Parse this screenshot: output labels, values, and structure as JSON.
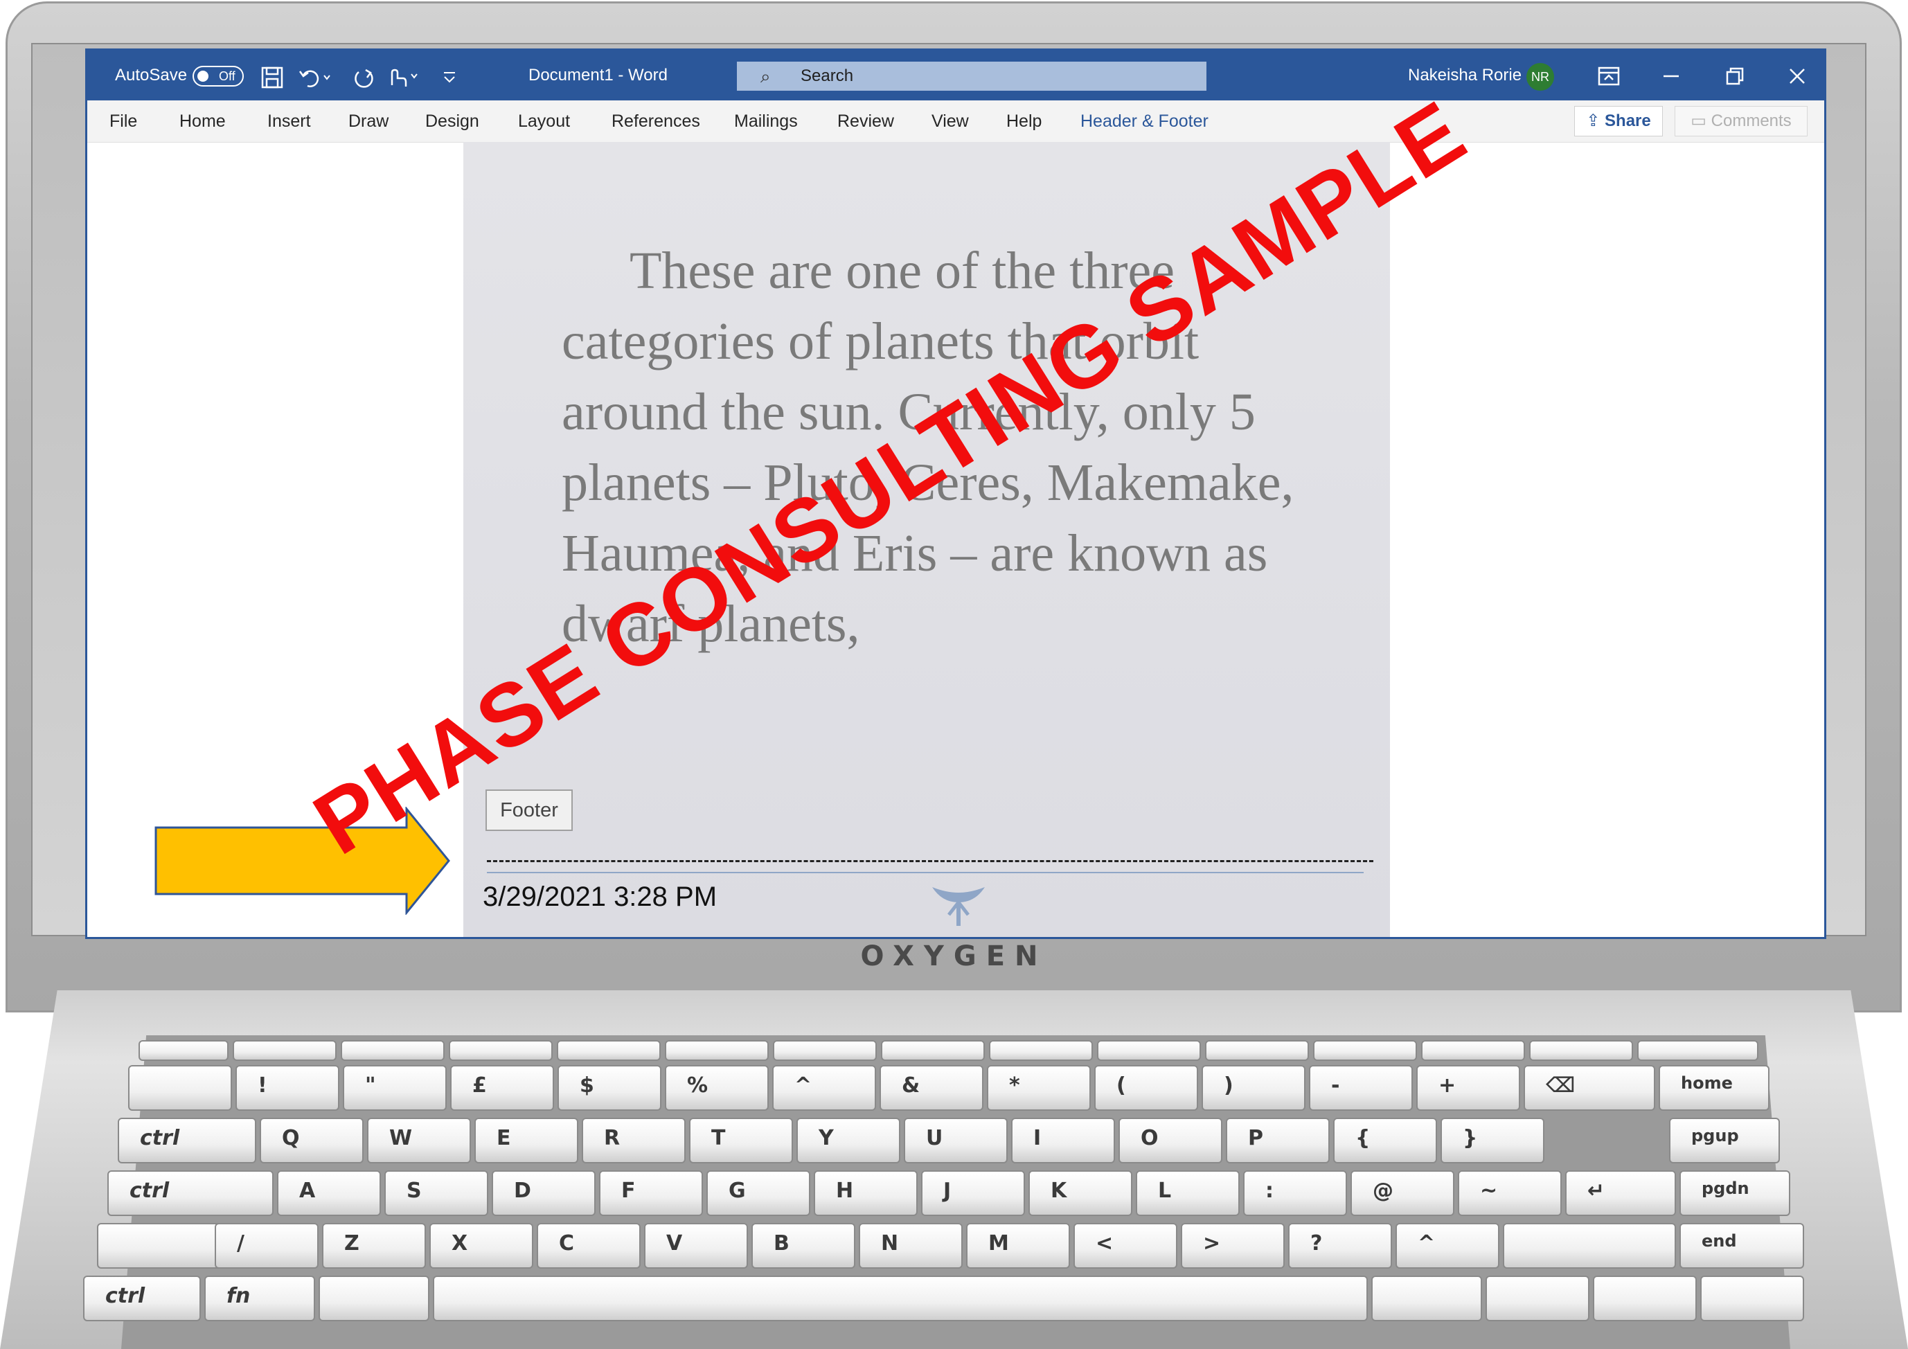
{
  "titlebar": {
    "autosave_label": "AutoSave",
    "autosave_state": "Off",
    "doc_title": "Document1  -  Word",
    "search_placeholder": "Search",
    "user_name": "Nakeisha Rorie",
    "user_initials": "NR"
  },
  "ribbon": {
    "tabs": [
      "File",
      "Home",
      "Insert",
      "Draw",
      "Design",
      "Layout",
      "References",
      "Mailings",
      "Review",
      "View",
      "Help",
      "Header & Footer"
    ],
    "active_tab": "Header & Footer",
    "share_label": "Share",
    "comments_label": "Comments"
  },
  "document": {
    "body_text": "These are one of the three categories of planets that orbit around the sun. Currently, only 5 planets – Pluto, Ceres, Makemake, Haumea, and Eris – are known as dwarf planets,",
    "footer_tag": "Footer",
    "footer_date": "3/29/2021 3:28 PM"
  },
  "laptop": {
    "brand": "OXYGEN"
  },
  "keyboard": {
    "row1": [
      "!",
      "\"",
      "£",
      "$",
      "%",
      "^",
      "&",
      "*",
      "(",
      ")",
      "-",
      "+",
      "⌫",
      "home"
    ],
    "row2": [
      "ctrl",
      "Q",
      "W",
      "E",
      "R",
      "T",
      "Y",
      "U",
      "I",
      "O",
      "P",
      "{",
      "}",
      "pgup"
    ],
    "row3": [
      "ctrl",
      "A",
      "S",
      "D",
      "F",
      "G",
      "H",
      "J",
      "K",
      "L",
      ":",
      "@",
      "~",
      "↵",
      "pgdn"
    ],
    "row4": [
      "/",
      "Z",
      "X",
      "C",
      "V",
      "B",
      "N",
      "M",
      "<",
      ">",
      "?",
      "^",
      "end"
    ],
    "row5": [
      "ctrl",
      "fn"
    ]
  },
  "watermark": "PHASE CONSULTING SAMPLE",
  "colors": {
    "word_blue": "#2b579a",
    "watermark_red": "#f20d0d",
    "arrow_yellow": "#ffc000"
  }
}
